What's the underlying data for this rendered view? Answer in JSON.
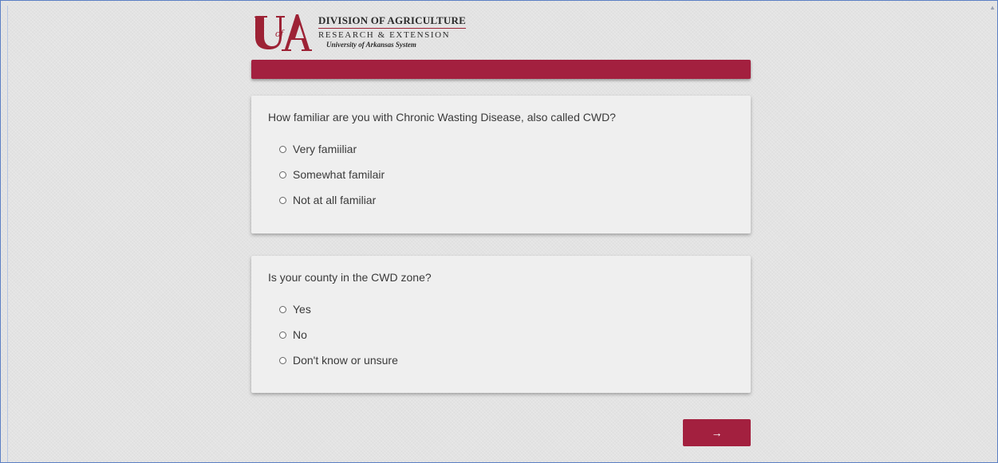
{
  "header": {
    "logo_mark": "UofA",
    "line1": "DIVISION OF AGRICULTURE",
    "line2": "RESEARCH & EXTENSION",
    "line3": "University of Arkansas System"
  },
  "colors": {
    "brand": "#a3203f",
    "page_background": "#e3e3e3",
    "card_background": "#efefef"
  },
  "questions": [
    {
      "text": "How familiar are you with Chronic Wasting Disease, also called CWD?",
      "options": [
        "Very famiiliar",
        "Somewhat familair",
        "Not at all familiar"
      ]
    },
    {
      "text": "Is your county in the CWD zone?",
      "options": [
        "Yes",
        "No",
        "Don't know or unsure"
      ]
    }
  ],
  "navigation": {
    "next_label": "→",
    "next_icon": "arrow-right-icon"
  }
}
